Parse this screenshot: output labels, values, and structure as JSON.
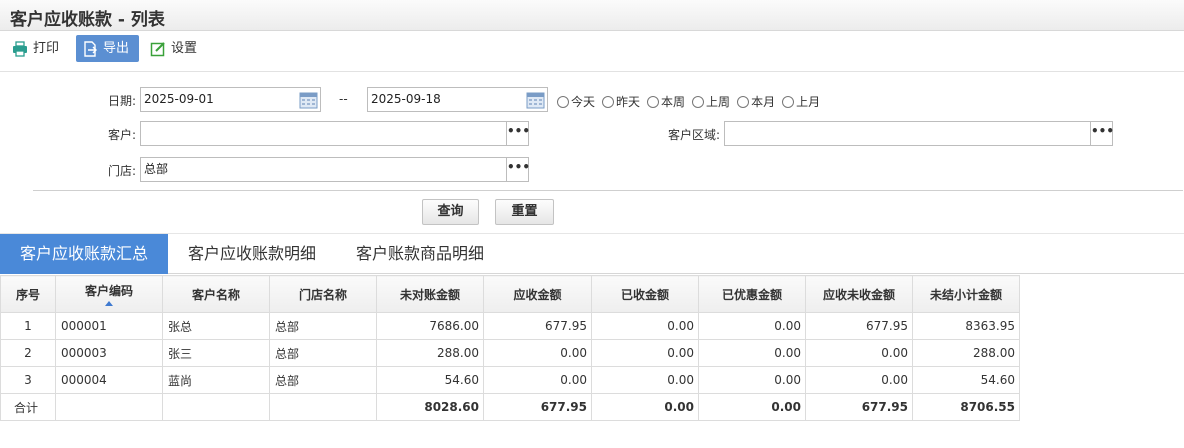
{
  "page": {
    "title": "客户应收账款 - 列表"
  },
  "toolbar": {
    "print": "打印",
    "export": "导出",
    "settings": "设置"
  },
  "filters": {
    "date_label": "日期:",
    "date_from": "2025-09-01",
    "date_sep": "--",
    "date_to": "2025-09-18",
    "quick_ranges": [
      "今天",
      "昨天",
      "本周",
      "上周",
      "本月",
      "上月"
    ],
    "customer_label": "客户:",
    "customer_value": "",
    "region_label": "客户区域:",
    "region_value": "",
    "store_label": "门店:",
    "store_value": "总部",
    "browse_label": "•••"
  },
  "actions": {
    "query": "查询",
    "reset": "重置"
  },
  "tabs": [
    "客户应收账款汇总",
    "客户应收账款明细",
    "客户账款商品明细"
  ],
  "table": {
    "columns": [
      "序号",
      "客户编码",
      "客户名称",
      "门店名称",
      "未对账金额",
      "应收金额",
      "已收金额",
      "已优惠金额",
      "应收未收金额",
      "未结小计金额"
    ],
    "rows": [
      [
        "1",
        "000001",
        "张总",
        "总部",
        "7686.00",
        "677.95",
        "0.00",
        "0.00",
        "677.95",
        "8363.95"
      ],
      [
        "2",
        "000003",
        "张三",
        "总部",
        "288.00",
        "0.00",
        "0.00",
        "0.00",
        "0.00",
        "288.00"
      ],
      [
        "3",
        "000004",
        "蓝尚",
        "总部",
        "54.60",
        "0.00",
        "0.00",
        "0.00",
        "0.00",
        "54.60"
      ]
    ],
    "total": [
      "合计",
      "",
      "",
      "",
      "8028.60",
      "677.95",
      "0.00",
      "0.00",
      "677.95",
      "8706.55"
    ]
  },
  "colors": {
    "accent": "#4a89d8",
    "export_button": "#5b8fd2"
  }
}
